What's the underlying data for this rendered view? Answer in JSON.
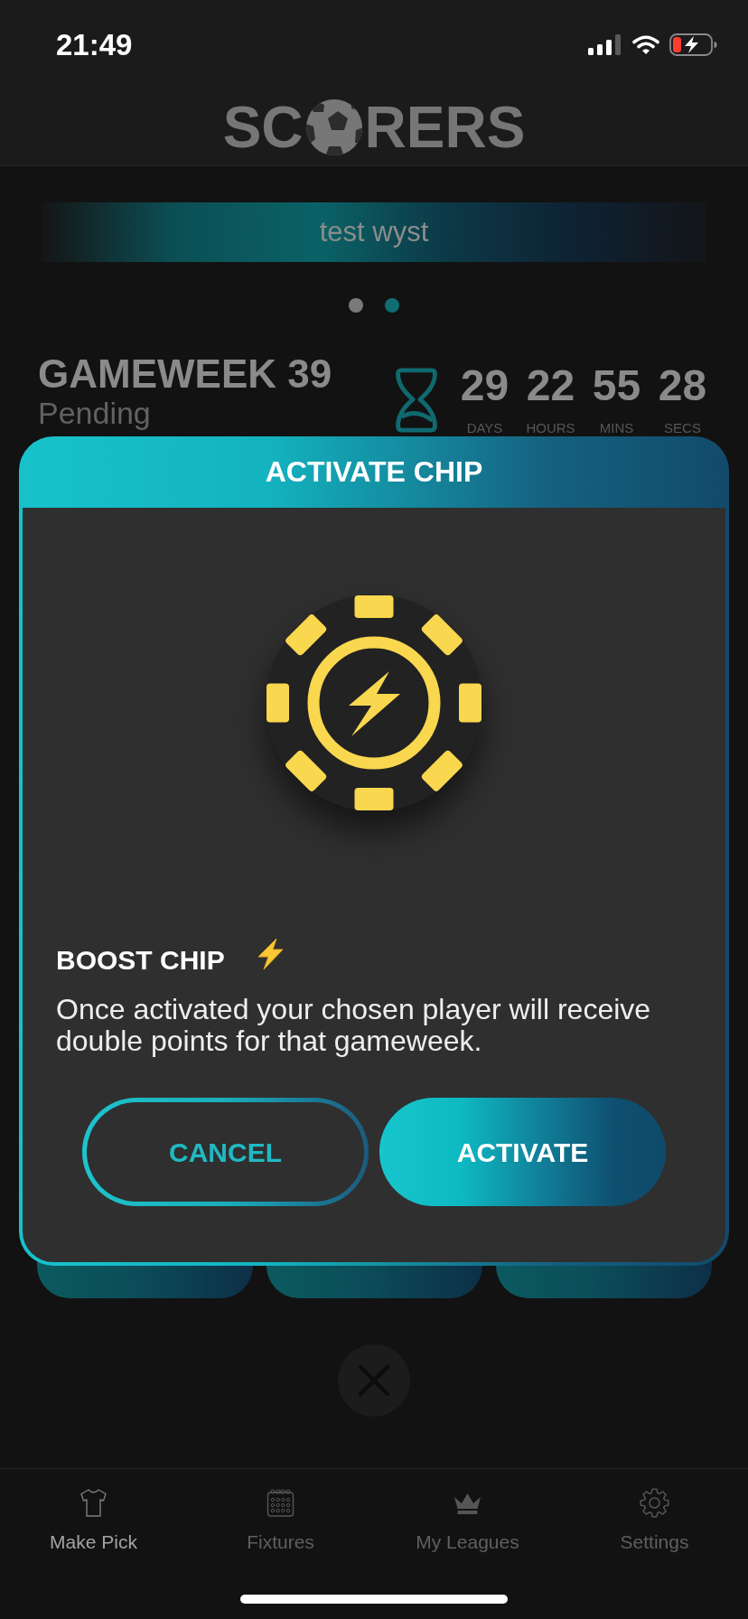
{
  "status_bar": {
    "time": "21:49"
  },
  "header": {
    "logo": {
      "before_ball": "SC",
      "after_ball": "RERS"
    }
  },
  "banner": {
    "text": "test wyst"
  },
  "pager_dots": [
    {
      "selected": false
    },
    {
      "selected": true
    }
  ],
  "gameweek": {
    "title": "GAMEWEEK 39",
    "status": "Pending",
    "countdown": [
      {
        "value": "29",
        "unit": "DAYS"
      },
      {
        "value": "22",
        "unit": "HOURS"
      },
      {
        "value": "55",
        "unit": "MINS"
      },
      {
        "value": "28",
        "unit": "SECS"
      }
    ]
  },
  "modal": {
    "title": "ACTIVATE CHIP",
    "chip_name": "BOOST CHIP",
    "description": "Once activated your chosen player will receive double points for that gameweek.",
    "buttons": [
      {
        "label": "CANCEL",
        "kind": "secondary"
      },
      {
        "label": "ACTIVATE",
        "kind": "primary"
      }
    ]
  },
  "tab_bar": [
    {
      "label": "Make Pick",
      "selected": true
    },
    {
      "label": "Fixtures",
      "selected": false
    },
    {
      "label": "My Leagues",
      "selected": false
    },
    {
      "label": "Settings",
      "selected": false
    }
  ]
}
